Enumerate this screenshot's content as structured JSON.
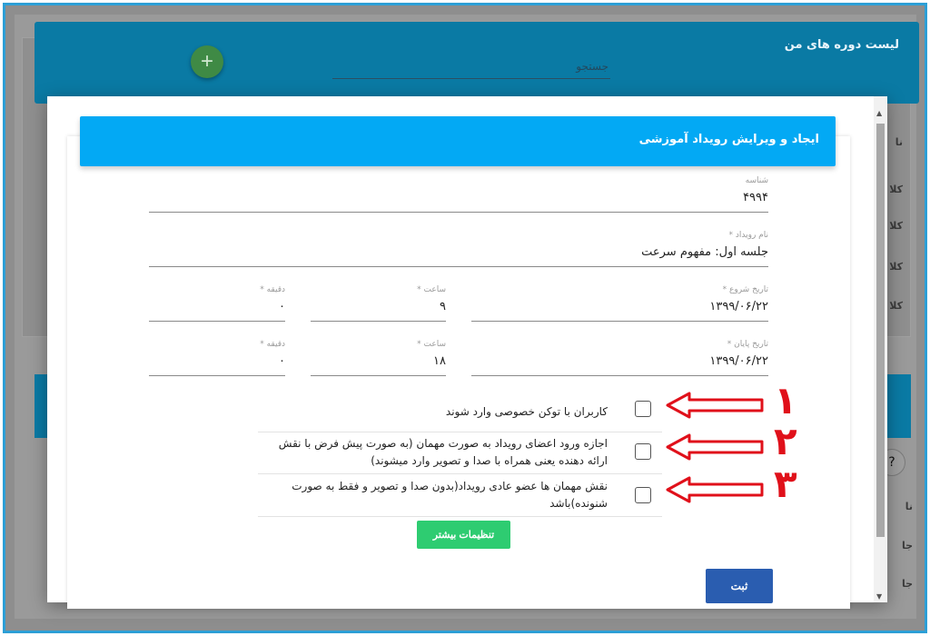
{
  "background": {
    "page_title": "لیست دوره های من",
    "search_placeholder": "جستجو",
    "add_button": "+",
    "side_rows": [
      "نا",
      "کلا",
      "کلا",
      "کلا",
      "کلا"
    ],
    "side_rows_lower": [
      "نا",
      "جا",
      "جا"
    ],
    "help_icon": "?"
  },
  "modal": {
    "title": "ایجاد و ویرایش رویداد آموزشی",
    "fields": {
      "id": {
        "label": "شناسه",
        "value": "۴۹۹۴"
      },
      "event_name": {
        "label": "نام رویداد *",
        "value": "جلسه اول: مفهوم سرعت"
      },
      "start_date": {
        "label": "تاریخ شروع *",
        "value": "۱۳۹۹/۰۶/۲۲"
      },
      "start_hour": {
        "label": "ساعت *",
        "value": "۹"
      },
      "start_minute": {
        "label": "دقیقه *",
        "value": "۰"
      },
      "end_date": {
        "label": "تاریخ پایان *",
        "value": "۱۳۹۹/۰۶/۲۲"
      },
      "end_hour": {
        "label": "ساعت *",
        "value": "۱۸"
      },
      "end_minute": {
        "label": "دقیقه *",
        "value": "۰"
      }
    },
    "checkboxes": [
      {
        "text": "کاربران با توکن خصوصی وارد شوند",
        "checked": false
      },
      {
        "text": "اجازه ورود اعضای رویداد به صورت مهمان (به صورت پیش فرض با نقش ارائه دهنده یعنی همراه با صدا و تصویر وارد میشوند)",
        "checked": false
      },
      {
        "text": "نقش مهمان ها عضو عادی رویداد(بدون صدا و تصویر و فقط به صورت شنونده)باشد",
        "checked": false
      }
    ],
    "more_settings_label": "تنظیمات بیشتر",
    "submit_label": "ثبت"
  },
  "annotations": {
    "numbers": [
      "۱",
      "۲",
      "۳"
    ],
    "color": "#e0101a"
  },
  "colors": {
    "header_blue": "#03a9f4",
    "more_btn_green": "#2ecc71",
    "submit_blue": "#2a5db0"
  }
}
